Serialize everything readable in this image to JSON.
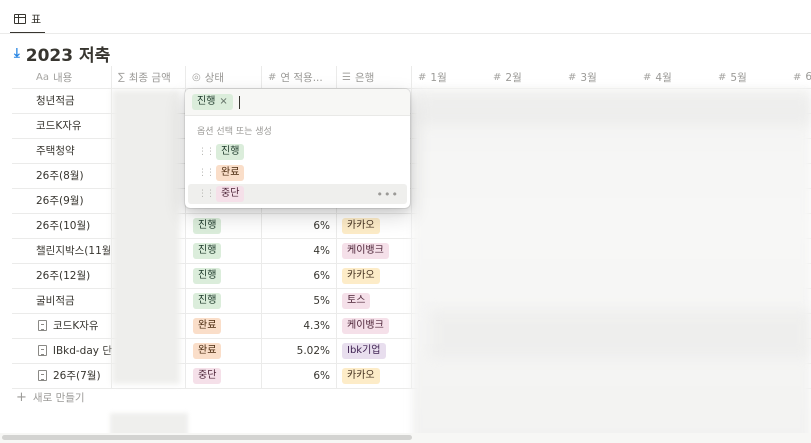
{
  "view_tab": {
    "label": "표"
  },
  "title": "2023 저축",
  "columns": [
    {
      "icon": "Aa",
      "label": "내용"
    },
    {
      "icon": "∑",
      "label": "최종 금액"
    },
    {
      "icon": "◎",
      "label": "상태"
    },
    {
      "icon": "#",
      "label": "연 적용..."
    },
    {
      "icon": "☰",
      "label": "은행"
    },
    {
      "icon": "#",
      "label": "1월"
    },
    {
      "icon": "#",
      "label": "2월"
    },
    {
      "icon": "#",
      "label": "3월"
    },
    {
      "icon": "#",
      "label": "4월"
    },
    {
      "icon": "#",
      "label": "5월"
    },
    {
      "icon": "#",
      "label": "6"
    }
  ],
  "rows": [
    {
      "name": "청년적금",
      "page": false,
      "status": "",
      "rate": "",
      "bank": ""
    },
    {
      "name": "코드K자유",
      "page": false,
      "status": "",
      "rate": "",
      "bank": ""
    },
    {
      "name": "주택청약",
      "page": false,
      "status": "",
      "rate": "",
      "bank": ""
    },
    {
      "name": "26주(8월)",
      "page": false,
      "status": "",
      "rate": "",
      "bank": ""
    },
    {
      "name": "26주(9월)",
      "page": false,
      "status": "",
      "rate": "",
      "bank": ""
    },
    {
      "name": "26주(10월)",
      "page": false,
      "status": "진행",
      "rate": "6%",
      "bank": "카카오"
    },
    {
      "name": "챌린지박스(11월",
      "page": false,
      "status": "진행",
      "rate": "4%",
      "bank": "케이뱅크"
    },
    {
      "name": "26주(12월)",
      "page": false,
      "status": "진행",
      "rate": "6%",
      "bank": "카카오"
    },
    {
      "name": "굴비적금",
      "page": false,
      "status": "진행",
      "rate": "5%",
      "bank": "토스"
    },
    {
      "name": "코드K자유",
      "page": true,
      "status": "완료",
      "rate": "4.3%",
      "bank": "케이뱅크"
    },
    {
      "name": "IBkd-day 단",
      "page": true,
      "status": "완료",
      "rate": "5.02%",
      "bank": "Ibk기업"
    },
    {
      "name": "26주(7월)",
      "page": true,
      "status": "중단",
      "rate": "6%",
      "bank": "카카오"
    }
  ],
  "new_row_label": "새로 만들기",
  "status_colors": {
    "진행": "green",
    "완료": "orange",
    "중단": "pink"
  },
  "bank_colors": {
    "카카오": "yellow",
    "케이뱅크": "pink",
    "토스": "pink",
    "Ibk기업": "purple"
  },
  "dropdown": {
    "selected_chip": "진행",
    "remove_label": "×",
    "hint": "옵션 선택 또는 생성",
    "options": [
      {
        "label": "진행",
        "color": "green"
      },
      {
        "label": "완료",
        "color": "orange"
      },
      {
        "label": "중단",
        "color": "pink"
      }
    ],
    "more_label": "•••"
  }
}
